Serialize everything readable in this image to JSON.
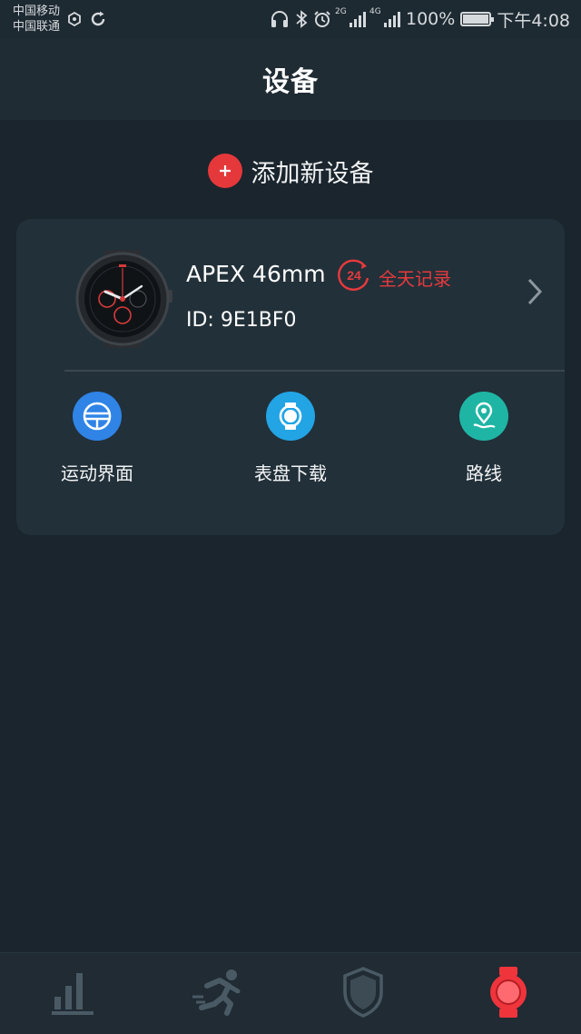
{
  "status_bar": {
    "carrier_1": "中国移动",
    "carrier_2": "中国联通",
    "net_2g": "2G",
    "net_4g": "4G",
    "battery_percent": "100%",
    "battery_level": 1.0,
    "time": "下午4:08"
  },
  "header": {
    "title": "设备"
  },
  "add_device": {
    "label": "添加新设备",
    "icon": "plus-icon",
    "accent": "#e5383b"
  },
  "device": {
    "name": "APEX 46mm",
    "allday_badge_number": "24",
    "allday_label": "全天记录",
    "id_text": "ID: 9E1BF0",
    "accent": "#e63a3d"
  },
  "actions": [
    {
      "label": "运动界面",
      "icon": "sport-interface-icon",
      "color": "#2f84e6"
    },
    {
      "label": "表盘下载",
      "icon": "watchface-icon",
      "color": "#22a4e5"
    },
    {
      "label": "路线",
      "icon": "route-icon",
      "color": "#1fb5a5"
    }
  ],
  "bottom_nav": [
    {
      "name": "statistics",
      "icon": "bar-chart-icon",
      "active": false
    },
    {
      "name": "sport",
      "icon": "running-icon",
      "active": false
    },
    {
      "name": "shield",
      "icon": "shield-icon",
      "active": false
    },
    {
      "name": "device",
      "icon": "watch-icon",
      "active": true,
      "color": "#f0343c"
    }
  ]
}
